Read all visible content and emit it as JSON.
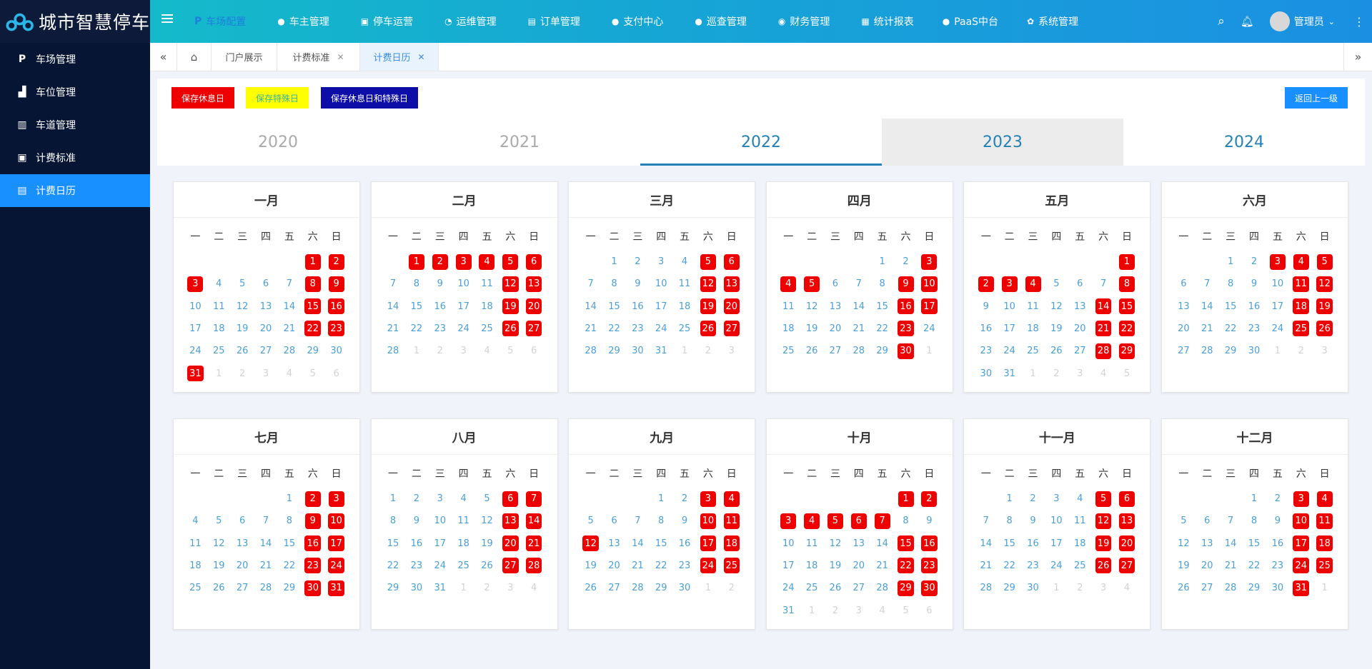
{
  "app": {
    "title": "城市智慧停车"
  },
  "top_nav": [
    {
      "label": "车场配置",
      "icon": "parking-icon",
      "active": true
    },
    {
      "label": "车主管理",
      "icon": "user-icon"
    },
    {
      "label": "停车运营",
      "icon": "operation-icon"
    },
    {
      "label": "运维管理",
      "icon": "dashboard-icon"
    },
    {
      "label": "订单管理",
      "icon": "order-icon"
    },
    {
      "label": "支付中心",
      "icon": "pay-icon"
    },
    {
      "label": "巡查管理",
      "icon": "inspect-icon"
    },
    {
      "label": "财务管理",
      "icon": "finance-icon"
    },
    {
      "label": "统计报表",
      "icon": "report-icon"
    },
    {
      "label": "PaaS中台",
      "icon": "cloud-icon"
    },
    {
      "label": "系统管理",
      "icon": "settings-icon"
    }
  ],
  "user": {
    "name": "管理员"
  },
  "sidebar": [
    {
      "label": "车场管理",
      "icon": "parking-icon"
    },
    {
      "label": "车位管理",
      "icon": "road-icon"
    },
    {
      "label": "车道管理",
      "icon": "barrier-icon"
    },
    {
      "label": "计费标准",
      "icon": "fee-icon"
    },
    {
      "label": "计费日历",
      "icon": "calendar-icon",
      "active": true
    }
  ],
  "tabs": [
    {
      "label": "门户展示"
    },
    {
      "label": "计费标准",
      "closable": true
    },
    {
      "label": "计费日历",
      "closable": true,
      "active": true
    }
  ],
  "toolbar": {
    "save_rest": "保存休息日",
    "save_special": "保存特殊日",
    "save_both": "保存休息日和特殊日",
    "back": "返回上一级"
  },
  "years": [
    "2020",
    "2021",
    "2022",
    "2023",
    "2024"
  ],
  "selected_year": "2022",
  "weekdays": [
    "一",
    "二",
    "三",
    "四",
    "五",
    "六",
    "日"
  ],
  "colors": {
    "holiday": "#ee0000",
    "accent": "#1890ff",
    "day_text": "#4a9fd8",
    "sidebar": "#061533"
  },
  "months": [
    {
      "name": "一月",
      "offset": 5,
      "days": 31,
      "holidays": [
        1,
        2,
        3,
        8,
        9,
        15,
        16,
        22,
        23,
        31
      ]
    },
    {
      "name": "二月",
      "offset": 1,
      "days": 28,
      "holidays": [
        1,
        2,
        3,
        4,
        5,
        6,
        12,
        13,
        19,
        20,
        26,
        27
      ]
    },
    {
      "name": "三月",
      "offset": 1,
      "days": 31,
      "holidays": [
        5,
        6,
        12,
        13,
        19,
        20,
        26,
        27
      ]
    },
    {
      "name": "四月",
      "offset": 4,
      "days": 30,
      "holidays": [
        3,
        4,
        5,
        9,
        10,
        16,
        17,
        23,
        30
      ]
    },
    {
      "name": "五月",
      "offset": 6,
      "days": 31,
      "holidays": [
        1,
        2,
        3,
        4,
        8,
        14,
        15,
        21,
        22,
        28,
        29
      ]
    },
    {
      "name": "六月",
      "offset": 2,
      "days": 30,
      "holidays": [
        3,
        4,
        5,
        11,
        12,
        18,
        19,
        25,
        26
      ]
    },
    {
      "name": "七月",
      "offset": 4,
      "days": 31,
      "holidays": [
        2,
        3,
        9,
        10,
        16,
        17,
        23,
        24,
        30,
        31
      ]
    },
    {
      "name": "八月",
      "offset": 0,
      "days": 31,
      "holidays": [
        6,
        7,
        13,
        14,
        20,
        21,
        27,
        28
      ]
    },
    {
      "name": "九月",
      "offset": 3,
      "days": 30,
      "holidays": [
        3,
        4,
        10,
        11,
        12,
        17,
        18,
        24,
        25
      ]
    },
    {
      "name": "十月",
      "offset": 5,
      "days": 31,
      "holidays": [
        1,
        2,
        3,
        4,
        5,
        6,
        7,
        15,
        16,
        22,
        23,
        29,
        30
      ]
    },
    {
      "name": "十一月",
      "offset": 1,
      "days": 30,
      "holidays": [
        5,
        6,
        12,
        13,
        19,
        20,
        26,
        27
      ]
    },
    {
      "name": "十二月",
      "offset": 3,
      "days": 31,
      "holidays": [
        3,
        4,
        10,
        11,
        17,
        18,
        24,
        25,
        31
      ]
    }
  ]
}
